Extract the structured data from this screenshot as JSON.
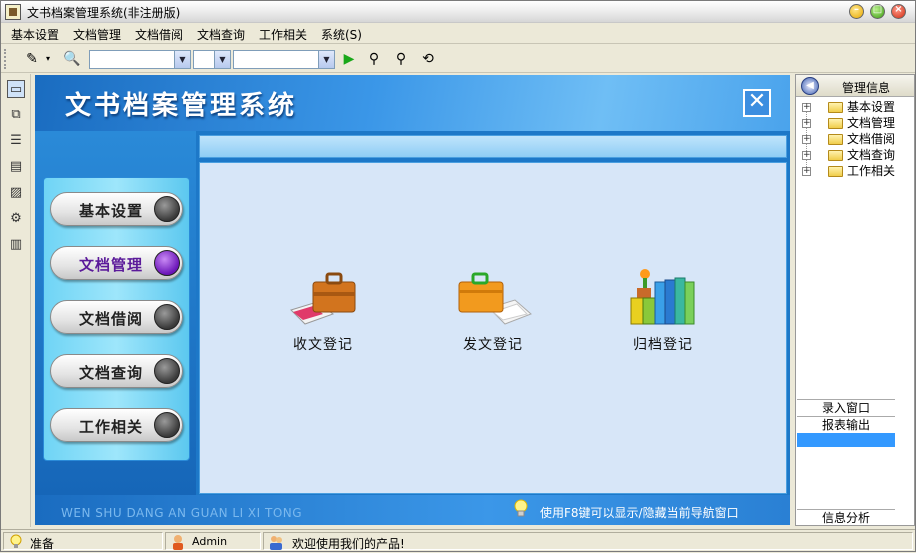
{
  "window": {
    "title": "文书档案管理系统(非注册版)"
  },
  "menu": [
    "基本设置",
    "文档管理",
    "文档借阅",
    "文档查询",
    "工作相关",
    "系统(S)"
  ],
  "banner": {
    "title": "文书档案管理系统"
  },
  "nav_buttons": [
    "基本设置",
    "文档管理",
    "文档借阅",
    "文档查询",
    "工作相关"
  ],
  "nav_active": "文档管理",
  "features": [
    {
      "label": "收文登记",
      "icon": "briefcase-icon"
    },
    {
      "label": "发文登记",
      "icon": "orange-briefcase-icon"
    },
    {
      "label": "归档登记",
      "icon": "binders-icon"
    }
  ],
  "footer": {
    "pinyin": "WEN SHU DANG AN GUAN LI XI TONG",
    "hint": "使用F8键可以显示/隐藏当前导航窗口"
  },
  "right_panel": {
    "title": "管理信息",
    "tree": [
      "基本设置",
      "文档管理",
      "文档借阅",
      "文档查询",
      "工作相关"
    ],
    "buttons": [
      "录入窗口",
      "报表输出"
    ],
    "bottom_button": "信息分析"
  },
  "status": {
    "ready": "准备",
    "user": "Admin",
    "welcome": "欢迎使用我们的产品!"
  },
  "colors": {
    "banner_blue": "#1d78c8",
    "content_bg": "#d7e6f8",
    "active_nav": "#6a14b8",
    "selection": "#3399ff"
  }
}
